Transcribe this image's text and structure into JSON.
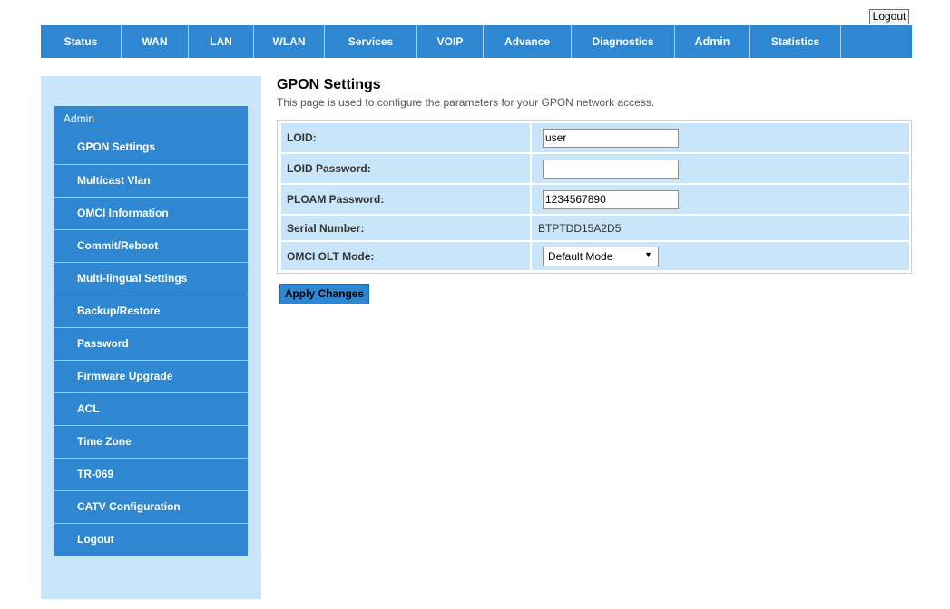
{
  "header": {
    "logout_label": "Logout"
  },
  "topnav": {
    "tabs": [
      {
        "label": "Status"
      },
      {
        "label": "WAN"
      },
      {
        "label": "LAN"
      },
      {
        "label": "WLAN"
      },
      {
        "label": "Services"
      },
      {
        "label": "VOIP"
      },
      {
        "label": "Advance"
      },
      {
        "label": "Diagnostics"
      },
      {
        "label": "Admin",
        "active": true
      },
      {
        "label": "Statistics"
      },
      {
        "label": ""
      }
    ]
  },
  "sidebar": {
    "group_title": "Admin",
    "items": [
      {
        "label": "GPON Settings"
      },
      {
        "label": "Multicast Vlan"
      },
      {
        "label": "OMCI Information"
      },
      {
        "label": "Commit/Reboot"
      },
      {
        "label": "Multi-lingual Settings"
      },
      {
        "label": "Backup/Restore"
      },
      {
        "label": "Password"
      },
      {
        "label": "Firmware Upgrade"
      },
      {
        "label": "ACL"
      },
      {
        "label": "Time Zone"
      },
      {
        "label": "TR-069"
      },
      {
        "label": "CATV Configuration"
      },
      {
        "label": "Logout"
      }
    ]
  },
  "main": {
    "title": "GPON Settings",
    "description": "This page is used to configure the parameters for your GPON network access.",
    "fields": {
      "loid": {
        "label": "LOID:",
        "value": "user"
      },
      "loid_password": {
        "label": "LOID Password:",
        "value": ""
      },
      "ploam_password": {
        "label": "PLOAM Password:",
        "value": "1234567890"
      },
      "serial_number": {
        "label": "Serial Number:",
        "value": "BTPTDD15A2D5"
      },
      "omci_olt_mode": {
        "label": "OMCI OLT Mode:",
        "value": "Default Mode"
      }
    },
    "apply_label": "Apply Changes"
  },
  "colors": {
    "nav_blue": "#2e87d0",
    "panel_light_blue": "#c8e5f9"
  },
  "icons": {
    "select_arrow": "triangle-down-icon"
  }
}
